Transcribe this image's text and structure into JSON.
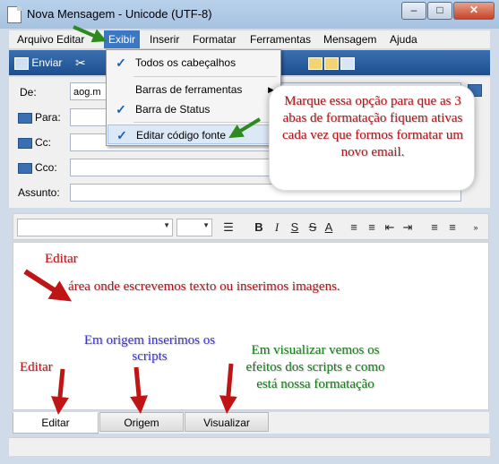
{
  "window": {
    "title": "Nova Mensagem - Unicode (UTF-8)",
    "minimize_glyph": "–",
    "maximize_glyph": "□",
    "close_glyph": "✕"
  },
  "menu": {
    "items": [
      "Arquivo",
      "Editar",
      "Exibir",
      "Inserir",
      "Formatar",
      "Ferramentas",
      "Mensagem",
      "Ajuda"
    ],
    "active": "Exibir"
  },
  "toolbar": {
    "send_label": "Enviar"
  },
  "header_fields": {
    "from_label": "De:",
    "from_value": "aog.m",
    "to_label": "Para:",
    "cc_label": "Cc:",
    "bcc_label": "Cco:",
    "subject_label": "Assunto:"
  },
  "view_menu": {
    "items": [
      {
        "label": "Todos os cabeçalhos",
        "checked": true
      },
      {
        "label": "Barras de ferramentas",
        "checked": false,
        "submenu": true
      },
      {
        "label": "Barra de Status",
        "checked": true
      },
      {
        "label": "Editar código fonte",
        "checked": true
      }
    ]
  },
  "tabs": {
    "items": [
      "Editar",
      "Origem",
      "Visualizar"
    ],
    "selected": "Editar"
  },
  "annotations": {
    "callout": "Marque essa opção para que as 3 abas de formatação fiquem ativas cada vez que formos formatar um novo email.",
    "editar_top": "Editar",
    "editor_area": "área onde escrevemos texto ou inserimos imagens.",
    "origem": "Em origem inserimos os scripts",
    "editar_bottom": "Editar",
    "visualizar": "Em visualizar vemos os efeitos dos scripts e como está nossa formatação"
  },
  "colors": {
    "menu_highlight": "#3b78c4",
    "toolbar_blue": "#2a5fa0",
    "annotation_red": "#b0161b",
    "annotation_blue": "#3b34c9",
    "annotation_green": "#177a1a",
    "arrow_red": "#c01515",
    "arrow_green": "#2e8a1e"
  }
}
